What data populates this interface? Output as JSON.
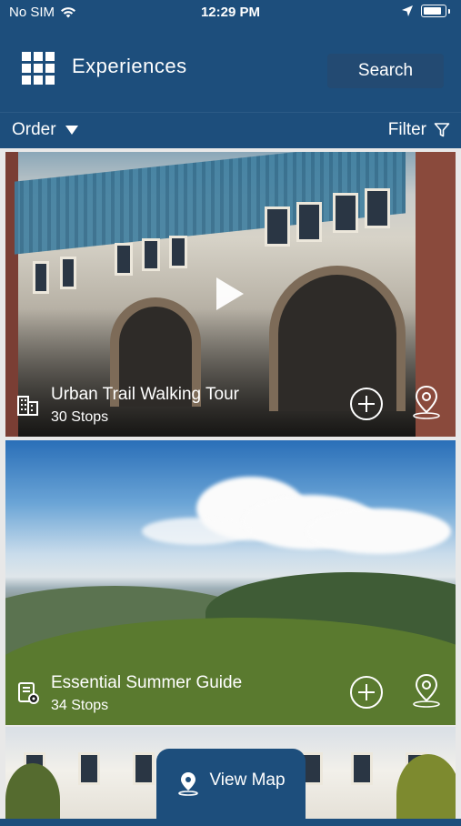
{
  "status_bar": {
    "carrier": "No SIM",
    "time": "12:29 PM"
  },
  "header": {
    "title": "Experiences",
    "search_label": "Search",
    "menu_icon": "grid-icon"
  },
  "subbar": {
    "order_label": "Order",
    "filter_label": "Filter"
  },
  "cards": [
    {
      "title": "Urban Trail Walking Tour",
      "subtitle": "30 Stops",
      "type_icon": "building-icon",
      "has_video": true
    },
    {
      "title": "Essential Summer Guide",
      "subtitle": "34 Stops",
      "type_icon": "guide-icon",
      "has_video": false
    }
  ],
  "view_map": {
    "label": "View Map"
  },
  "colors": {
    "brand": "#1d4e7c",
    "search_bg": "#234a72"
  }
}
